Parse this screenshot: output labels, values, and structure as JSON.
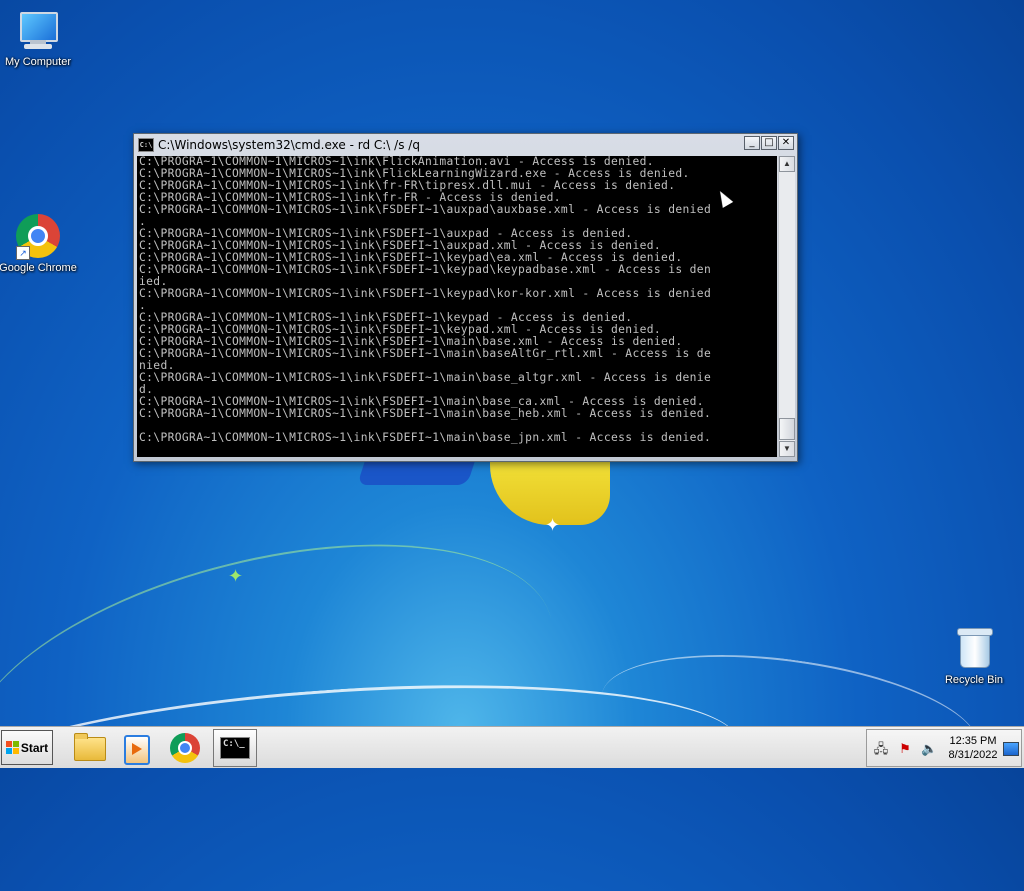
{
  "desktop": {
    "icons": [
      {
        "label": "My Computer",
        "icon": "computer-icon"
      },
      {
        "label": "Google Chrome",
        "icon": "chrome-icon"
      },
      {
        "label": "Recycle Bin",
        "icon": "recycle-bin-icon"
      }
    ]
  },
  "cmd_window": {
    "title": "C:\\Windows\\system32\\cmd.exe - rd  C:\\ /s /q",
    "buttons": {
      "minimize": "_",
      "maximize": "□",
      "close": "✕"
    },
    "lines": [
      "C:\\PROGRA~1\\COMMON~1\\MICROS~1\\ink\\FlickAnimation.avi - Access is denied.",
      "C:\\PROGRA~1\\COMMON~1\\MICROS~1\\ink\\FlickLearningWizard.exe - Access is denied.",
      "C:\\PROGRA~1\\COMMON~1\\MICROS~1\\ink\\fr-FR\\tipresx.dll.mui - Access is denied.",
      "C:\\PROGRA~1\\COMMON~1\\MICROS~1\\ink\\fr-FR - Access is denied.",
      "C:\\PROGRA~1\\COMMON~1\\MICROS~1\\ink\\FSDEFI~1\\auxpad\\auxbase.xml - Access is denied",
      ".",
      "C:\\PROGRA~1\\COMMON~1\\MICROS~1\\ink\\FSDEFI~1\\auxpad - Access is denied.",
      "C:\\PROGRA~1\\COMMON~1\\MICROS~1\\ink\\FSDEFI~1\\auxpad.xml - Access is denied.",
      "C:\\PROGRA~1\\COMMON~1\\MICROS~1\\ink\\FSDEFI~1\\keypad\\ea.xml - Access is denied.",
      "C:\\PROGRA~1\\COMMON~1\\MICROS~1\\ink\\FSDEFI~1\\keypad\\keypadbase.xml - Access is den",
      "ied.",
      "C:\\PROGRA~1\\COMMON~1\\MICROS~1\\ink\\FSDEFI~1\\keypad\\kor-kor.xml - Access is denied",
      ".",
      "C:\\PROGRA~1\\COMMON~1\\MICROS~1\\ink\\FSDEFI~1\\keypad - Access is denied.",
      "C:\\PROGRA~1\\COMMON~1\\MICROS~1\\ink\\FSDEFI~1\\keypad.xml - Access is denied.",
      "C:\\PROGRA~1\\COMMON~1\\MICROS~1\\ink\\FSDEFI~1\\main\\base.xml - Access is denied.",
      "C:\\PROGRA~1\\COMMON~1\\MICROS~1\\ink\\FSDEFI~1\\main\\baseAltGr_rtl.xml - Access is de",
      "nied.",
      "C:\\PROGRA~1\\COMMON~1\\MICROS~1\\ink\\FSDEFI~1\\main\\base_altgr.xml - Access is denie",
      "d.",
      "C:\\PROGRA~1\\COMMON~1\\MICROS~1\\ink\\FSDEFI~1\\main\\base_ca.xml - Access is denied.",
      "C:\\PROGRA~1\\COMMON~1\\MICROS~1\\ink\\FSDEFI~1\\main\\base_heb.xml - Access is denied.",
      "",
      "C:\\PROGRA~1\\COMMON~1\\MICROS~1\\ink\\FSDEFI~1\\main\\base_jpn.xml - Access is denied."
    ]
  },
  "taskbar": {
    "start_label": "Start",
    "apps": [
      {
        "name": "Windows Explorer",
        "icon": "folder-icon"
      },
      {
        "name": "Windows Media Player",
        "icon": "media-player-icon"
      },
      {
        "name": "Google Chrome",
        "icon": "chrome-icon"
      },
      {
        "name": "Command Prompt",
        "icon": "cmd-icon",
        "active": true
      }
    ],
    "tray": {
      "icons": [
        "network-icon",
        "action-center-icon",
        "volume-icon"
      ],
      "time": "12:35 PM",
      "date": "8/31/2022"
    }
  },
  "colors": {
    "desktop_blue": "#0f62c4",
    "console_bg": "#000000",
    "console_text": "#c0c0c0"
  }
}
